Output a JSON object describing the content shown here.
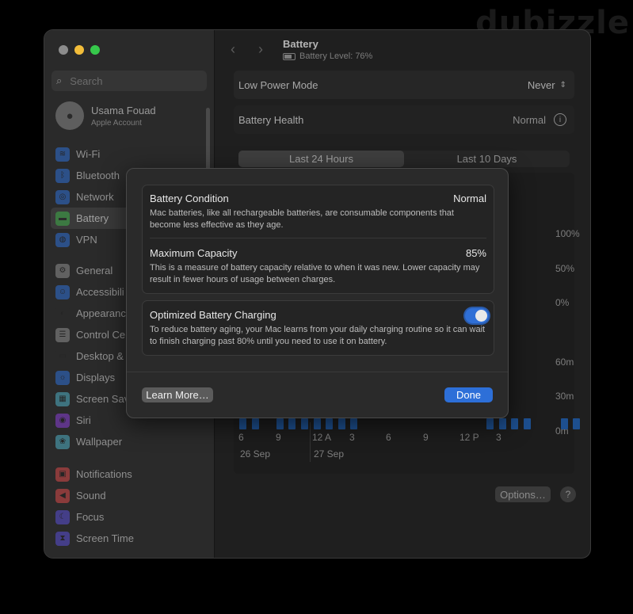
{
  "watermark": "dubizzle",
  "window": {
    "search": {
      "placeholder": "Search"
    },
    "profile": {
      "name": "Usama Fouad",
      "subtitle": "Apple Account"
    },
    "sidebar": {
      "groups": [
        [
          {
            "label": "Wi-Fi",
            "icon": "wifi-icon",
            "color": "#2f6fd6",
            "glyph": "≋"
          },
          {
            "label": "Bluetooth",
            "icon": "bluetooth-icon",
            "color": "#2f6fd6",
            "glyph": "ᛒ"
          },
          {
            "label": "Network",
            "icon": "network-icon",
            "color": "#2f6fd6",
            "glyph": "◎"
          },
          {
            "label": "Battery",
            "icon": "battery-icon",
            "color": "#3fae4a",
            "glyph": "▬",
            "active": true
          },
          {
            "label": "VPN",
            "icon": "vpn-icon",
            "color": "#2f6fd6",
            "glyph": "◍"
          }
        ],
        [
          {
            "label": "General",
            "icon": "gear-icon",
            "color": "#8e8e8e",
            "glyph": "⚙"
          },
          {
            "label": "Accessibili",
            "icon": "accessibility-icon",
            "color": "#2f6fd6",
            "glyph": "☺"
          },
          {
            "label": "Appearanc",
            "icon": "appearance-icon",
            "color": "#2a2a2a",
            "glyph": "◐"
          },
          {
            "label": "Control Ce",
            "icon": "control-center-icon",
            "color": "#8e8e8e",
            "glyph": "☰"
          },
          {
            "label": "Desktop &",
            "icon": "desktop-dock-icon",
            "color": "#2a2a2a",
            "glyph": "▭"
          },
          {
            "label": "Displays",
            "icon": "displays-icon",
            "color": "#2f6fd6",
            "glyph": "☼"
          },
          {
            "label": "Screen Sav",
            "icon": "screen-saver-icon",
            "color": "#4fb0c6",
            "glyph": "▦"
          },
          {
            "label": "Siri",
            "icon": "siri-icon",
            "color": "#8a3fd6",
            "glyph": "◉"
          },
          {
            "label": "Wallpaper",
            "icon": "wallpaper-icon",
            "color": "#4fb0c6",
            "glyph": "❀"
          }
        ],
        [
          {
            "label": "Notifications",
            "icon": "notifications-icon",
            "color": "#d94a4a",
            "glyph": "▣"
          },
          {
            "label": "Sound",
            "icon": "sound-icon",
            "color": "#d94a4a",
            "glyph": "◀"
          },
          {
            "label": "Focus",
            "icon": "focus-icon",
            "color": "#5a4fd6",
            "glyph": "☾"
          },
          {
            "label": "Screen Time",
            "icon": "screen-time-icon",
            "color": "#5a4fd6",
            "glyph": "⧗"
          }
        ]
      ]
    },
    "header": {
      "title": "Battery",
      "battery_level": "Battery Level: 76%"
    },
    "low_power": {
      "label": "Low Power Mode",
      "value": "Never"
    },
    "battery_health": {
      "label": "Battery Health",
      "value": "Normal"
    },
    "tabs": [
      "Last 24 Hours",
      "Last 10 Days"
    ],
    "chart": {
      "level_labels": [
        "100%",
        "50%",
        "0%"
      ],
      "usage_labels": [
        "60m",
        "30m",
        "0m"
      ],
      "time_ticks": [
        "6",
        "9",
        "12 A",
        "3",
        "6",
        "9",
        "12 P",
        "3"
      ],
      "dates": [
        "26 Sep",
        "27 Sep"
      ]
    },
    "options_label": "Options…",
    "help_label": "?"
  },
  "chart_data": {
    "type": "bar",
    "title": "",
    "x": [
      "6",
      "9",
      "12 A",
      "3",
      "6",
      "9",
      "12 P",
      "3"
    ],
    "ylabel": "",
    "ylim": [
      0,
      60
    ],
    "series": [
      {
        "values": [
          5,
          5,
          0,
          5,
          3,
          5,
          5,
          5,
          5,
          5,
          0,
          0,
          0,
          0,
          0,
          0,
          0,
          0,
          0,
          0,
          3,
          5,
          5,
          5,
          0,
          0,
          5,
          5,
          0,
          0
        ]
      }
    ],
    "color": "#1d4f8f"
  },
  "sheet": {
    "condition": {
      "label": "Battery Condition",
      "value": "Normal",
      "description": "Mac batteries, like all rechargeable batteries, are consumable components that become less effective as they age."
    },
    "capacity": {
      "label": "Maximum Capacity",
      "value": "85%",
      "description": "This is a measure of battery capacity relative to when it was new. Lower capacity may result in fewer hours of usage between charges."
    },
    "optimized": {
      "label": "Optimized Battery Charging",
      "enabled": true,
      "description": "To reduce battery aging, your Mac learns from your daily charging routine so it can wait to finish charging past 80% until you need to use it on battery."
    },
    "learn_more": "Learn More…",
    "done": "Done"
  }
}
